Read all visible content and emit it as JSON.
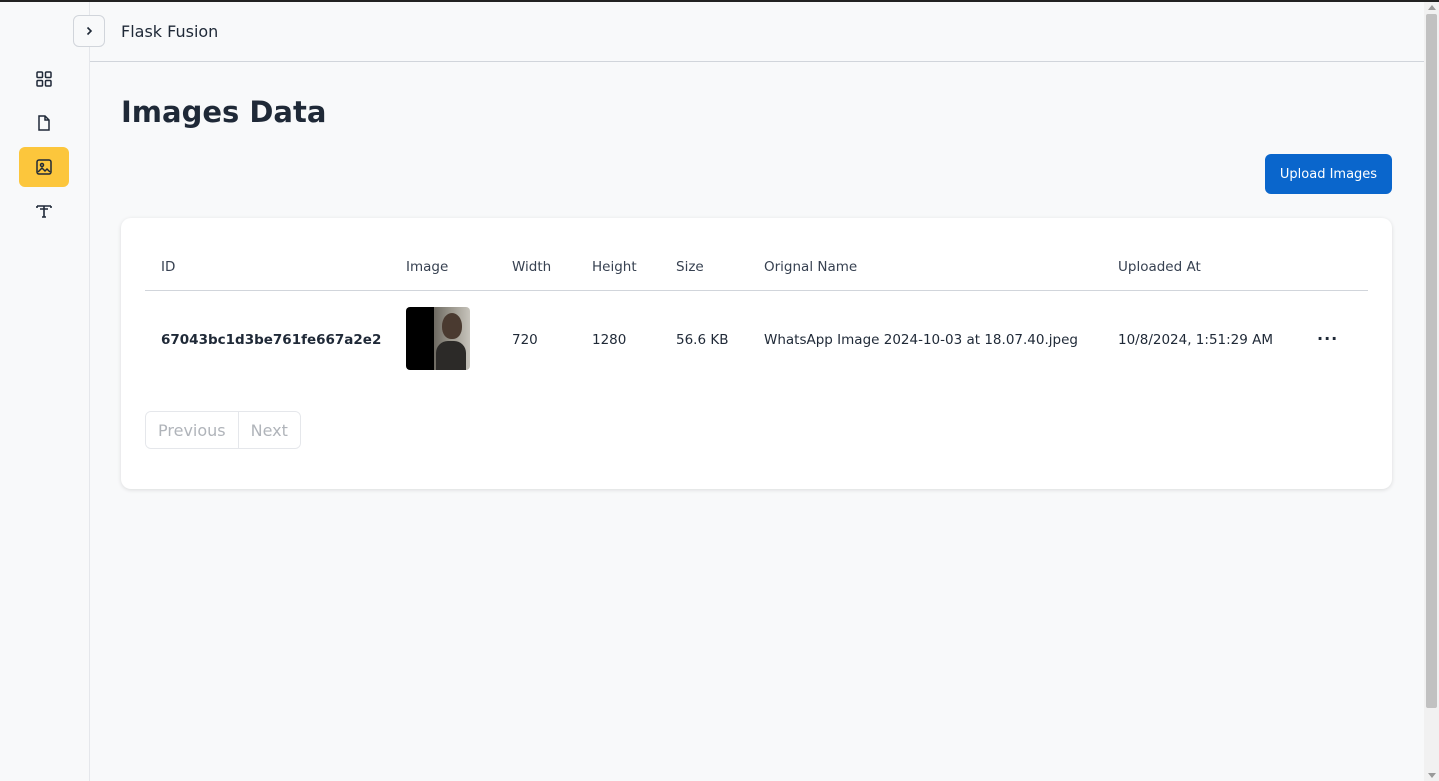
{
  "app": {
    "title": "Flask Fusion"
  },
  "sidebar": {
    "items": [
      {
        "icon": "dashboard-grid-icon",
        "active": false
      },
      {
        "icon": "document-icon",
        "active": false
      },
      {
        "icon": "image-icon",
        "active": true
      },
      {
        "icon": "text-type-icon",
        "active": false
      }
    ],
    "toggle_icon": "chevron-right-icon"
  },
  "page": {
    "title": "Images Data"
  },
  "toolbar": {
    "upload_label": "Upload Images"
  },
  "table": {
    "columns": [
      "ID",
      "Image",
      "Width",
      "Height",
      "Size",
      "Orignal Name",
      "Uploaded At"
    ],
    "rows": [
      {
        "id": "67043bc1d3be761fe667a2e2",
        "width": "720",
        "height": "1280",
        "size": "56.6 KB",
        "original_name": "WhatsApp Image 2024-10-03 at 18.07.40.jpeg",
        "uploaded_at": "10/8/2024, 1:51:29 AM",
        "actions_label": "···"
      }
    ]
  },
  "pagination": {
    "previous_label": "Previous",
    "next_label": "Next"
  },
  "colors": {
    "accent": "#0a66cc",
    "active_nav": "#fcc63c"
  }
}
